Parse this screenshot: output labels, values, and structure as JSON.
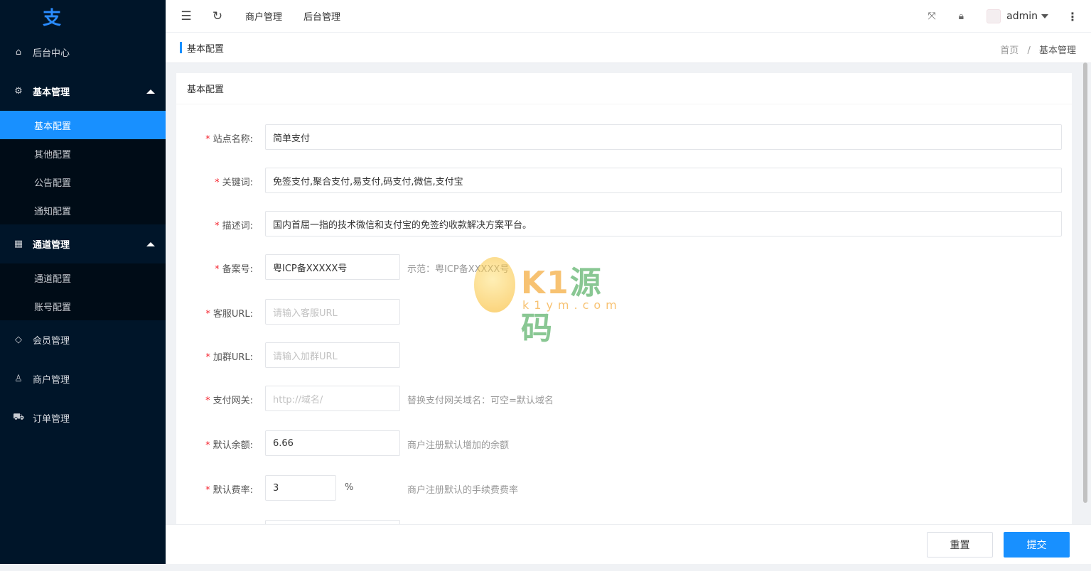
{
  "sidebar": {
    "logo_glyph": "支",
    "items": [
      {
        "label": "后台中心",
        "icon": "home-icon"
      },
      {
        "label": "基本管理",
        "icon": "gear-icon"
      },
      {
        "label": "通道管理",
        "icon": "apps-icon"
      },
      {
        "label": "会员管理",
        "icon": "diamond-icon"
      },
      {
        "label": "商户管理",
        "icon": "user-icon"
      },
      {
        "label": "订单管理",
        "icon": "cart-icon"
      }
    ],
    "basic_sub": [
      "基本配置",
      "其他配置",
      "公告配置",
      "通知配置"
    ],
    "channel_sub": [
      "通道配置",
      "账号配置"
    ]
  },
  "header": {
    "nav": [
      "商户管理",
      "后台管理"
    ],
    "user": "admin"
  },
  "titlebar": {
    "title": "基本配置",
    "breadcrumb_home": "首页",
    "breadcrumb_sep": "/",
    "breadcrumb_current": "基本管理"
  },
  "card": {
    "title": "基本配置"
  },
  "form": {
    "site_name": {
      "label": "站点名称:",
      "value": "简单支付"
    },
    "keywords": {
      "label": "关键词:",
      "value": "免签支付,聚合支付,易支付,码支付,微信,支付宝"
    },
    "description": {
      "label": "描述词:",
      "value": "国内首屈一指的技术微信和支付宝的免签约收款解决方案平台。"
    },
    "icp": {
      "label": "备案号:",
      "value": "粤ICP备XXXXX号",
      "tip": "示范：粤ICP备XXXXX号"
    },
    "service_url": {
      "label": "客服URL:",
      "placeholder": "请输入客服URL"
    },
    "group_url": {
      "label": "加群URL:",
      "placeholder": "请输入加群URL"
    },
    "gateway": {
      "label": "支付网关:",
      "placeholder": "http://域名/",
      "tip": "替换支付网关域名：可空=默认域名"
    },
    "default_balance": {
      "label": "默认余额:",
      "value": "6.66",
      "tip": "商户注册默认增加的余额"
    },
    "default_rate": {
      "label": "默认费率:",
      "value": "3",
      "unit": "%",
      "tip": "商户注册默认的手续费费率"
    },
    "required_mark": "*"
  },
  "footer": {
    "reset": "重置",
    "submit": "提交"
  },
  "watermark": {
    "brand_a": "K1",
    "brand_b": "源码",
    "domain": "k1ym.com"
  },
  "colors": {
    "sidebar_bg": "#001529",
    "accent": "#1890ff",
    "required": "#f5222d"
  }
}
